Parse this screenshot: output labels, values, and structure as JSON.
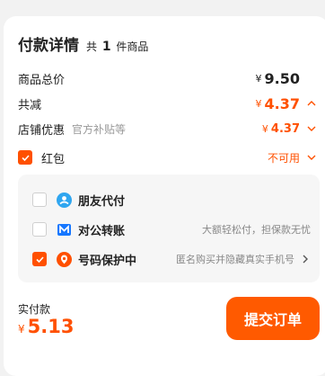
{
  "header": {
    "title": "付款详情",
    "count_prefix": "共",
    "count_value": "1",
    "count_suffix": "件商品"
  },
  "summary": {
    "goods_total": {
      "label": "商品总价",
      "currency": "¥",
      "amount": "9.50"
    },
    "discount": {
      "label": "共减",
      "currency": "¥",
      "amount": "4.37"
    },
    "shop_discount": {
      "label": "店铺优惠",
      "sub": "官方补贴等",
      "currency": "¥",
      "amount": "4.37"
    },
    "red_packet": {
      "label": "红包",
      "status": "不可用",
      "checked": true
    }
  },
  "payment_options": [
    {
      "name": "朋友代付",
      "desc": "",
      "checked": false,
      "icon": "friend-pay-icon",
      "color": "#2fa6f0"
    },
    {
      "name": "对公转账",
      "desc": "大额轻松付，担保款无忧",
      "checked": false,
      "icon": "bank-transfer-icon",
      "color": "#1677ff"
    },
    {
      "name": "号码保护中",
      "desc": "匿名购买并隐藏真实手机号",
      "checked": true,
      "icon": "number-protect-icon",
      "color": "#ff5000"
    }
  ],
  "footer": {
    "label": "实付款",
    "currency": "¥",
    "amount": "5.13",
    "submit_label": "提交订单"
  },
  "colors": {
    "accent": "#ff5000",
    "button": "#ff5a00"
  }
}
